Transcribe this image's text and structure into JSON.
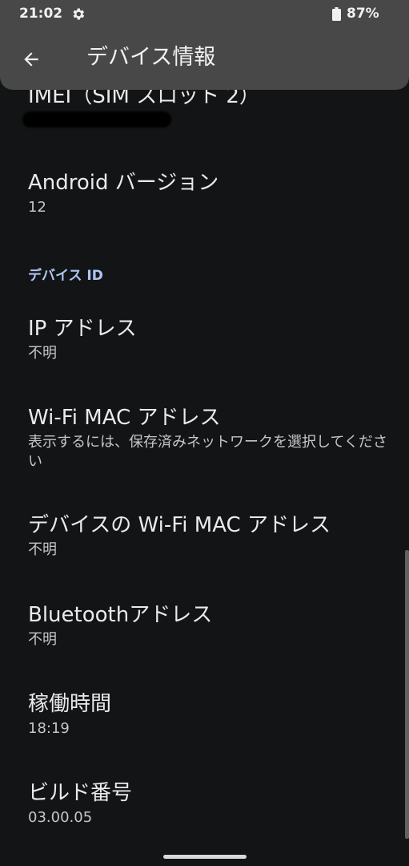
{
  "status_bar": {
    "time": "21:02",
    "battery": "87%"
  },
  "app_bar": {
    "title": "デバイス情報"
  },
  "items": [
    {
      "title": "IMEI（SIM スロット 2）",
      "summary": ""
    },
    {
      "title": "Android バージョン",
      "summary": "12"
    },
    {
      "title": "IP アドレス",
      "summary": "不明"
    },
    {
      "title": "Wi-Fi MAC アドレス",
      "summary": "表示するには、保存済みネットワークを選択してください"
    },
    {
      "title": "デバイスの Wi-Fi MAC アドレス",
      "summary": "不明"
    },
    {
      "title": "Bluetoothアドレス",
      "summary": "不明"
    },
    {
      "title": "稼働時間",
      "summary": "18:19"
    },
    {
      "title": "ビルド番号",
      "summary": "03.00.05"
    }
  ],
  "section_header": "デバイス ID",
  "icons": {
    "back": "arrow-back-icon",
    "settings": "gear-icon",
    "battery": "battery-icon"
  },
  "colors": {
    "background": "#131415",
    "app_bar": "#484848",
    "section_header": "#aec6f5"
  }
}
